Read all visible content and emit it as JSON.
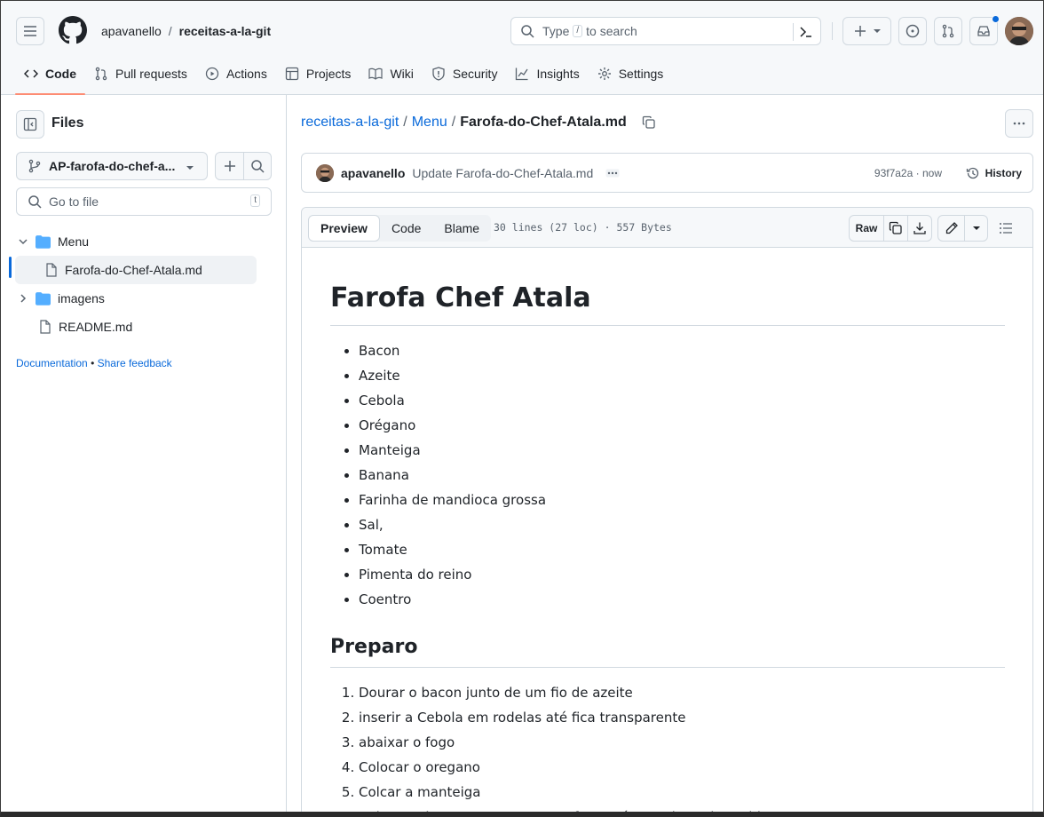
{
  "header": {
    "owner": "apavanello",
    "separator": "/",
    "repo": "receitas-a-la-git",
    "search": {
      "type_label": "Type",
      "key": "/",
      "to_search": "to search"
    }
  },
  "repo_nav": {
    "tabs": [
      {
        "label": "Code",
        "icon": "code-icon"
      },
      {
        "label": "Pull requests",
        "icon": "pull-request-icon"
      },
      {
        "label": "Actions",
        "icon": "play-icon"
      },
      {
        "label": "Projects",
        "icon": "table-icon"
      },
      {
        "label": "Wiki",
        "icon": "book-icon"
      },
      {
        "label": "Security",
        "icon": "shield-icon"
      },
      {
        "label": "Insights",
        "icon": "graph-icon"
      },
      {
        "label": "Settings",
        "icon": "gear-icon"
      }
    ]
  },
  "sidebar": {
    "title": "Files",
    "branch": "AP-farofa-do-chef-a...",
    "go_to_file_placeholder": "Go to file",
    "go_to_file_key": "t",
    "tree": [
      {
        "label": "Menu",
        "type": "folder",
        "expanded": true
      },
      {
        "label": "Farofa-do-Chef-Atala.md",
        "type": "file",
        "selected": true
      },
      {
        "label": "imagens",
        "type": "folder",
        "expanded": false
      },
      {
        "label": "README.md",
        "type": "file"
      }
    ],
    "links": {
      "documentation": "Documentation",
      "dot": "•",
      "feedback": "Share feedback"
    }
  },
  "main": {
    "breadcrumb": {
      "repo": "receitas-a-la-git",
      "sep": "/",
      "folder": "Menu",
      "file": "Farofa-do-Chef-Atala.md"
    },
    "commit": {
      "author": "apavanello",
      "message": "Update Farofa-do-Chef-Atala.md",
      "sha": "93f7a2a",
      "sep": "·",
      "time": "now",
      "history_label": "History"
    },
    "viewer": {
      "tabs": [
        "Preview",
        "Code",
        "Blame"
      ],
      "meta": "30 lines (27 loc) · 557 Bytes",
      "raw_label": "Raw"
    },
    "doc": {
      "title": "Farofa Chef Atala",
      "ingredients": [
        "Bacon",
        "Azeite",
        "Cebola",
        "Orégano",
        "Manteiga",
        "Banana",
        "Farinha de mandioca grossa",
        "Sal,",
        "Tomate",
        "Pimenta do reino",
        "Coentro"
      ],
      "section": "Preparo",
      "steps": [
        "Dourar o bacon junto de um fio de azeite",
        "inserir a Cebola em rodelas até fica transparente",
        "abaixar o fogo",
        "Colocar o oregano",
        "Colcar a manteiga",
        "Colocar a banana e aumentar o fogo até uma dourada rapida"
      ]
    }
  }
}
